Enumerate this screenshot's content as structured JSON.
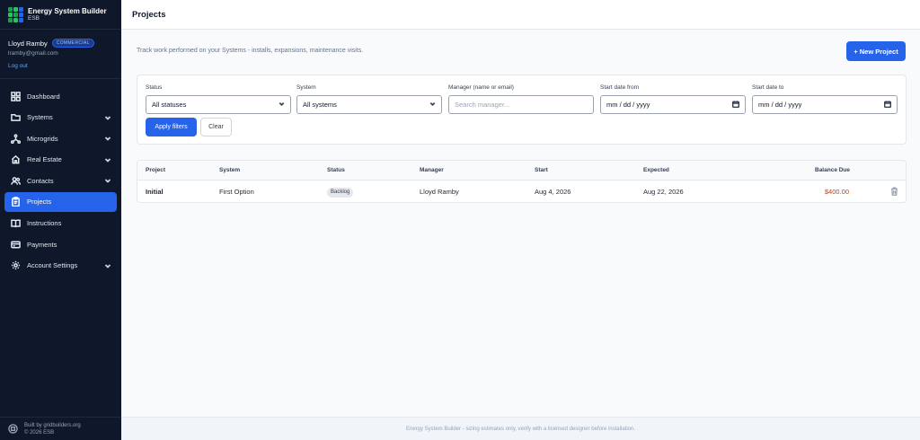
{
  "brand": {
    "title": "Energy System Builder",
    "subtitle": "ESB"
  },
  "user": {
    "name": "Lloyd Ramby",
    "plan": "COMMERCIAL",
    "email": "lramby@gmail.com",
    "logout": "Log out"
  },
  "nav": [
    {
      "label": "Dashboard",
      "icon": "grid-icon",
      "expandable": false,
      "active": false
    },
    {
      "label": "Systems",
      "icon": "folder-icon",
      "expandable": true,
      "active": false
    },
    {
      "label": "Microgrids",
      "icon": "network-icon",
      "expandable": true,
      "active": false
    },
    {
      "label": "Real Estate",
      "icon": "home-icon",
      "expandable": true,
      "active": false
    },
    {
      "label": "Contacts",
      "icon": "users-icon",
      "expandable": true,
      "active": false
    },
    {
      "label": "Projects",
      "icon": "clipboard-icon",
      "expandable": false,
      "active": true
    },
    {
      "label": "Instructions",
      "icon": "book-icon",
      "expandable": false,
      "active": false
    },
    {
      "label": "Payments",
      "icon": "card-icon",
      "expandable": false,
      "active": false
    },
    {
      "label": "Account Settings",
      "icon": "gear-icon",
      "expandable": true,
      "active": false
    }
  ],
  "sidebar_footer": {
    "line1": "Built by gridbuilders.org",
    "line2": "© 2026 ESB"
  },
  "page": {
    "title": "Projects",
    "intro": "Track work performed on your Systems - installs, expansions, maintenance visits.",
    "new_button": "+ New Project"
  },
  "filters": {
    "status": {
      "label": "Status",
      "value": "All statuses"
    },
    "system": {
      "label": "System",
      "value": "All systems"
    },
    "manager": {
      "label": "Manager (name or email)",
      "placeholder": "Search manager..."
    },
    "start_from": {
      "label": "Start date from",
      "value": "mm / dd / yyyy"
    },
    "start_to": {
      "label": "Start date to",
      "value": "mm / dd / yyyy"
    },
    "apply": "Apply filters",
    "clear": "Clear"
  },
  "table": {
    "headers": {
      "project": "Project",
      "system": "System",
      "status": "Status",
      "manager": "Manager",
      "start": "Start",
      "expected": "Expected",
      "balance": "Balance Due"
    },
    "rows": [
      {
        "project": "Initial",
        "system": "First Option",
        "status": "Backlog",
        "manager": "Lloyd Ramby",
        "start": "Aug 4, 2026",
        "expected": "Aug 22, 2026",
        "balance": "$400.00"
      }
    ]
  },
  "footer": "Energy System Builder - sizing estimates only, verify with a licensed designer before installation.",
  "colors": {
    "sidebar_bg": "#0f172a",
    "accent": "#2563eb",
    "balance": "#c2410c"
  }
}
